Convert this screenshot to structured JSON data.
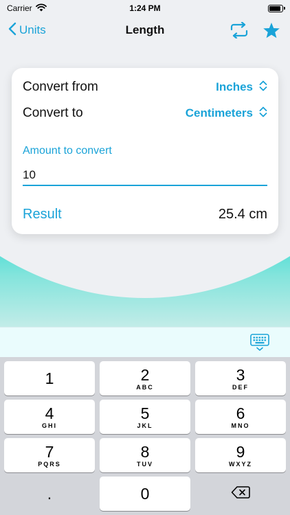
{
  "status_bar": {
    "carrier": "Carrier",
    "time": "1:24 PM",
    "battery_level": 0.95
  },
  "nav": {
    "back_label": "Units",
    "title": "Length",
    "swap_icon": "swap-icon",
    "favorite_icon": "star-icon"
  },
  "converter": {
    "from_label": "Convert from",
    "from_unit": "Inches",
    "to_label": "Convert to",
    "to_unit": "Centimeters",
    "amount_label": "Amount to convert",
    "amount_value": "10",
    "result_label": "Result",
    "result_value": "25.4 cm"
  },
  "keyboard": {
    "toggle_icon": "keyboard-dismiss-icon",
    "keys": [
      {
        "digit": "1",
        "letters": ""
      },
      {
        "digit": "2",
        "letters": "ABC"
      },
      {
        "digit": "3",
        "letters": "DEF"
      },
      {
        "digit": "4",
        "letters": "GHI"
      },
      {
        "digit": "5",
        "letters": "JKL"
      },
      {
        "digit": "6",
        "letters": "MNO"
      },
      {
        "digit": "7",
        "letters": "PQRS"
      },
      {
        "digit": "8",
        "letters": "TUV"
      },
      {
        "digit": "9",
        "letters": "WXYZ"
      },
      {
        "digit": ".",
        "letters": ""
      },
      {
        "digit": "0",
        "letters": ""
      }
    ],
    "delete_icon": "backspace-icon"
  },
  "colors": {
    "accent": "#1aa3d8",
    "gradient_top": "#1a6cf0",
    "gradient_mid": "#14c6e0",
    "gradient_bottom": "#c2ece8",
    "keypad_bg": "#d3d5da"
  }
}
